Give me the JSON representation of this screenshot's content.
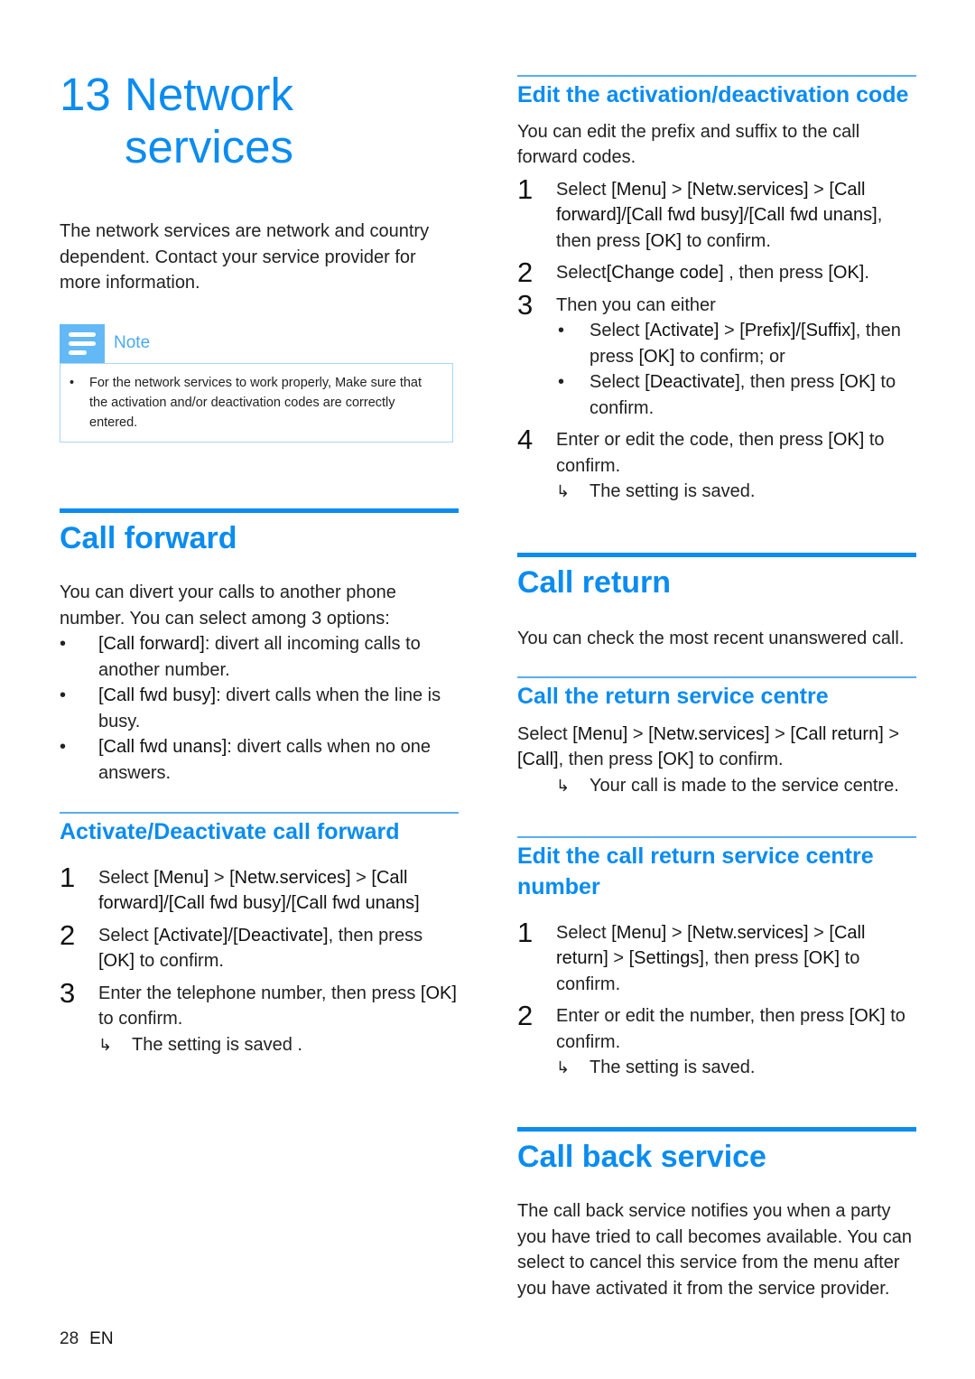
{
  "chapter": {
    "number": "13",
    "title_line1": "Network",
    "title_line2": "services"
  },
  "intro": "The network services are network and country dependent. Contact your service provider for more information.",
  "note": {
    "label": "Note",
    "icon": "note-lines-icon",
    "items": [
      "For the network services to work properly, Make sure that the activation and/or deactivation codes are correctly entered."
    ]
  },
  "call_forward": {
    "title": "Call forward",
    "intro": "You can divert your calls to another phone number. You can select among 3 options:",
    "options": [
      {
        "term": "[Call forward]",
        "desc": ": divert all incoming calls to another number."
      },
      {
        "term": "[Call fwd busy]",
        "desc": ": divert calls when the line is busy."
      },
      {
        "term": "[Call fwd unans]",
        "desc": ": divert calls when no one answers."
      }
    ],
    "activate": {
      "title": "Activate/Deactivate call forward",
      "steps": [
        {
          "n": "1",
          "pre": "Select ",
          "b1": "[Menu]",
          "m1": " > ",
          "b2": "[Netw.services]",
          "m2": " > ",
          "b3": "[Call forward]/[Call fwd busy]/[Call fwd unans]"
        },
        {
          "n": "2",
          "pre": "Select ",
          "b1": "[Activate]/[Deactivate]",
          "post": ", then press ",
          "b2": "[OK]",
          "end": " to confirm."
        },
        {
          "n": "3",
          "pre": "Enter the telephone number, then press ",
          "b1": "[OK]",
          "end": " to confirm.",
          "result": "The setting is saved ."
        }
      ]
    }
  },
  "edit_code": {
    "title": "Edit the activation/deactivation code",
    "intro": "You can edit the prefix and suffix to the call forward codes.",
    "step1": {
      "n": "1",
      "pre": "Select ",
      "b1": "[Menu]",
      "m1": " > ",
      "b2": "[Netw.services]",
      "m2": " > ",
      "b3": "[Call forward]/[Call fwd busy]/[Call fwd unans]",
      "post": ", then press ",
      "b4": "[OK]",
      "end": " to confirm."
    },
    "step2": {
      "n": "2",
      "pre": "Select",
      "b1": "[Change code]",
      "post": " , then press ",
      "b2": "[OK]",
      "end": "."
    },
    "step3": {
      "n": "3",
      "text": "Then you can either",
      "bullets": [
        {
          "pre": "Select ",
          "b1": "[Activate]",
          "m": " > ",
          "b2": "[Prefix]/[Suffix]",
          "post": ", then press ",
          "b3": "[OK]",
          "end": " to confirm; or"
        },
        {
          "pre": "Select ",
          "b1": "[Deactivate]",
          "post": ", then press ",
          "b3": "[OK]",
          "end": " to confirm."
        }
      ]
    },
    "step4": {
      "n": "4",
      "pre": "Enter or edit the code, then press ",
      "b1": "[OK]",
      "end": " to confirm.",
      "result": "The setting is saved."
    }
  },
  "call_return": {
    "title": "Call return",
    "intro": "You can check the most recent unanswered call.",
    "centre": {
      "title": "Call the return service centre",
      "pre": "Select ",
      "b1": "[Menu]",
      "m1": " > ",
      "b2": "[Netw.services]",
      "m2": " > ",
      "b3": "[Call return]",
      "m3": " > ",
      "b4": "[Call]",
      "post": ", then press ",
      "b5": "[OK]",
      "end": " to confirm.",
      "result": "Your call is made to the service centre."
    },
    "edit": {
      "title": "Edit the call return service centre number",
      "step1": {
        "n": "1",
        "pre": "Select ",
        "b1": "[Menu]",
        "m1": " > ",
        "b2": "[Netw.services]",
        "m2": " > ",
        "b3": "[Call return]",
        "m3": " > ",
        "b4": "[Settings]",
        "post": ", then press ",
        "b5": "[OK]",
        "end": " to confirm."
      },
      "step2": {
        "n": "2",
        "pre": "Enter or edit the number, then press ",
        "b1": "[OK]",
        "end": " to confirm.",
        "result": "The setting is saved."
      }
    }
  },
  "call_back": {
    "title": "Call back service",
    "body": "The call back service notifies you when a party you have tried to call becomes available. You can select to cancel this service from the menu after you have activated it from the service provider."
  },
  "footer": {
    "page": "28",
    "lang": "EN"
  },
  "symbols": {
    "bullet": "•",
    "result_arrow": "↳"
  }
}
